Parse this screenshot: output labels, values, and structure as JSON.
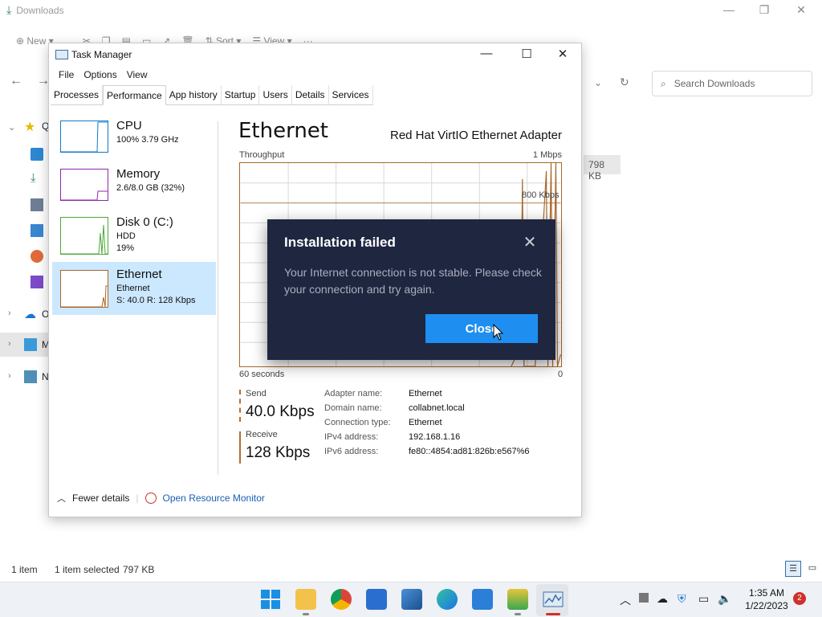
{
  "explorer": {
    "title": "Downloads",
    "toolbar": {
      "new_label": "New",
      "sort_label": "Sort",
      "view_label": "View",
      "more_label": "···"
    },
    "search_placeholder": "Search Downloads",
    "size_pill": "798 KB",
    "sidebar": {
      "quick_access_label": "Q",
      "onedrive_label": "O",
      "this_pc_label": "M",
      "network_label": "N"
    },
    "status": {
      "count": "1 item",
      "selected": "1 item selected",
      "selected_size": "797 KB"
    }
  },
  "task_manager": {
    "title": "Task Manager",
    "menu": [
      "File",
      "Options",
      "View"
    ],
    "tabs": [
      "Processes",
      "Performance",
      "App history",
      "Startup",
      "Users",
      "Details",
      "Services"
    ],
    "active_tab": "Performance",
    "resources": [
      {
        "name": "CPU",
        "line1": "100%  3.79 GHz",
        "line2": "",
        "color": "#1179c8"
      },
      {
        "name": "Memory",
        "line1": "2.6/8.0 GB (32%)",
        "line2": "",
        "color": "#8b2aa8"
      },
      {
        "name": "Disk 0 (C:)",
        "line1": "HDD",
        "line2": "19%",
        "color": "#4da83a"
      },
      {
        "name": "Ethernet",
        "line1": "Ethernet",
        "line2": "S: 40.0  R: 128 Kbps",
        "color": "#a8672a"
      }
    ],
    "selected_resource": "Ethernet",
    "detail": {
      "heading": "Ethernet",
      "adapter": "Red Hat VirtIO Ethernet Adapter",
      "throughput_label": "Throughput",
      "max_label": "1 Mbps",
      "mid_label": "800 Kbps",
      "time_label": "60 seconds",
      "zero_label": "0",
      "send_label": "Send",
      "send_value": "40.0 Kbps",
      "receive_label": "Receive",
      "receive_value": "128 Kbps",
      "info": [
        {
          "key": "Adapter name:",
          "value": "Ethernet"
        },
        {
          "key": "Domain name:",
          "value": "collabnet.local"
        },
        {
          "key": "Connection type:",
          "value": "Ethernet"
        },
        {
          "key": "IPv4 address:",
          "value": "192.168.1.16"
        },
        {
          "key": "IPv6 address:",
          "value": "fe80::4854:ad81:826b:e567%6"
        }
      ]
    },
    "footer": {
      "fewer_details": "Fewer details",
      "open_monitor": "Open Resource Monitor"
    }
  },
  "dialog": {
    "title": "Installation failed",
    "message": "Your Internet connection is not stable. Please check your connection and try again.",
    "close_button": "Close",
    "bg_color": "#1f2640",
    "button_color": "#1e8ff0"
  },
  "taskbar": {
    "time": "1:35 AM",
    "date": "1/22/2023",
    "notification_count": "2"
  }
}
